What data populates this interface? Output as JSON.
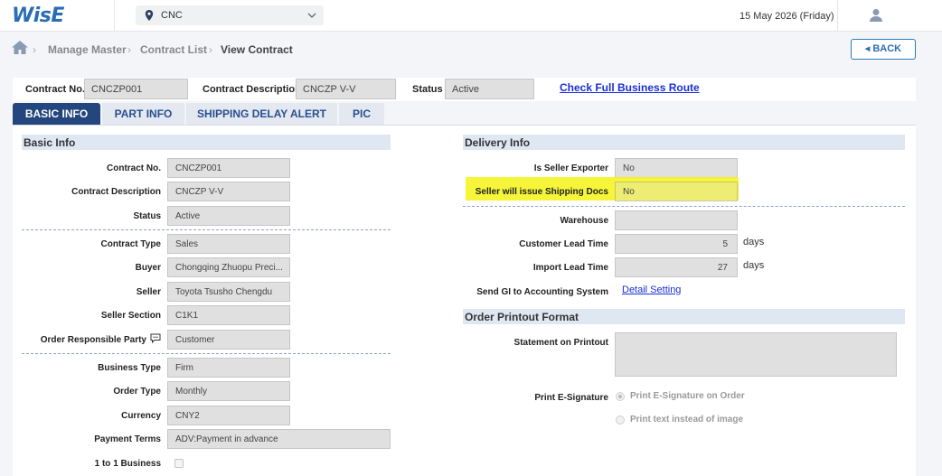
{
  "app": {
    "logo": "WisE",
    "location": "CNC",
    "date": "15 May 2026 (Friday)"
  },
  "breadcrumb": [
    "Manage Master",
    "Contract List",
    "View Contract"
  ],
  "back_label": "BACK",
  "header": {
    "contract_no_label": "Contract No.",
    "contract_no": "CNCZP001",
    "contract_desc_label": "Contract Description",
    "contract_desc": "CNCZP V-V",
    "status_label": "Status",
    "status": "Active",
    "route_link": "Check Full Business Route"
  },
  "tabs": [
    "BASIC INFO",
    "PART INFO",
    "SHIPPING DELAY ALERT",
    "PIC"
  ],
  "basic_info": {
    "title": "Basic Info",
    "fields": [
      {
        "label": "Contract No.",
        "value": "CNCZP001"
      },
      {
        "label": "Contract Description",
        "value": "CNCZP V-V"
      },
      {
        "label": "Status",
        "value": "Active"
      },
      {
        "label": "Contract Type",
        "value": "Sales"
      },
      {
        "label": "Buyer",
        "value": "Chongqing Zhuopu Preci..."
      },
      {
        "label": "Seller",
        "value": "Toyota Tsusho Chengdu"
      },
      {
        "label": "Seller Section",
        "value": "C1K1"
      },
      {
        "label": "Order Responsible Party",
        "value": "Customer"
      },
      {
        "label": "Business Type",
        "value": "Firm"
      },
      {
        "label": "Order Type",
        "value": "Monthly"
      },
      {
        "label": "Currency",
        "value": "CNY2"
      },
      {
        "label": "Payment Terms",
        "value": "ADV:Payment in advance"
      },
      {
        "label": "1 to 1 Business",
        "value": ""
      }
    ]
  },
  "delivery_info": {
    "title": "Delivery Info",
    "is_seller_exporter_label": "Is Seller Exporter",
    "is_seller_exporter": "No",
    "shipping_docs_label": "Seller will issue Shipping Docs",
    "shipping_docs": "No",
    "warehouse_label": "Warehouse",
    "warehouse": "",
    "customer_lead_label": "Customer Lead Time",
    "customer_lead": "5",
    "import_lead_label": "Import Lead Time",
    "import_lead": "27",
    "days_unit": "days",
    "send_gi_label": "Send GI to Accounting System",
    "send_gi_link": "Detail Setting"
  },
  "order_printout": {
    "title": "Order Printout Format",
    "statement_label": "Statement on Printout",
    "statement": "",
    "esig_label": "Print E-Signature",
    "esig_options": [
      "Print E-Signature on Order",
      "Print text instead of image"
    ]
  },
  "colors": {
    "accent": "#24467f",
    "link": "#1a2fd6",
    "highlight": "#f5f316"
  }
}
